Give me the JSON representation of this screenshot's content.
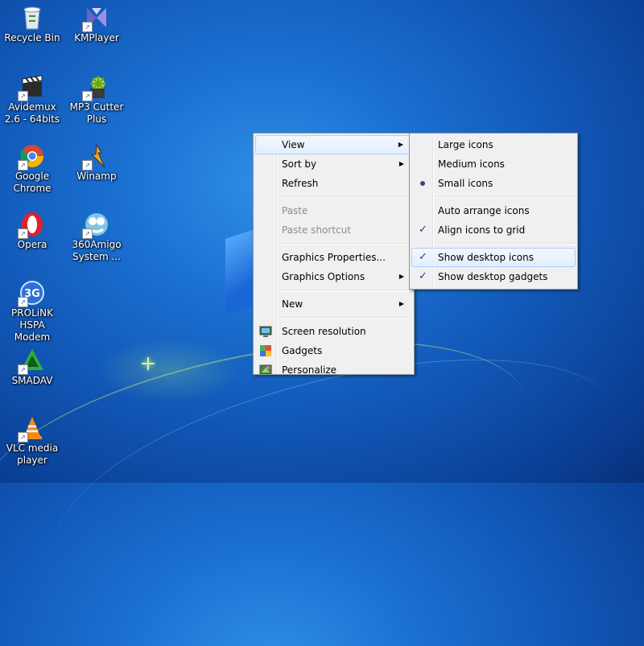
{
  "desktop": {
    "icons": [
      {
        "label": "Recycle Bin",
        "icon": "recycle-bin-icon"
      },
      {
        "label": "KMPlayer",
        "icon": "kmplayer-icon"
      },
      {
        "label": "Avidemux 2.6 - 64bits",
        "icon": "avidemux-icon"
      },
      {
        "label": "MP3 Cutter Plus",
        "icon": "mp3-cutter-icon"
      },
      {
        "label": "Google Chrome",
        "icon": "chrome-icon"
      },
      {
        "label": "Winamp",
        "icon": "winamp-icon"
      },
      {
        "label": "Opera",
        "icon": "opera-icon"
      },
      {
        "label": "360Amigo System ...",
        "icon": "360amigo-icon"
      },
      {
        "label": "PROLiNK HSPA Modem",
        "icon": "prolink-icon"
      },
      {
        "label": "SMADAV",
        "icon": "smadav-icon"
      },
      {
        "label": "VLC media player",
        "icon": "vlc-icon"
      }
    ]
  },
  "context_menu": {
    "items": [
      {
        "label": "View",
        "submenu": true,
        "highlighted": true
      },
      {
        "label": "Sort by",
        "submenu": true
      },
      {
        "label": "Refresh"
      },
      {
        "label": "Paste",
        "disabled": true
      },
      {
        "label": "Paste shortcut",
        "disabled": true
      },
      {
        "label": "Graphics Properties..."
      },
      {
        "label": "Graphics Options",
        "submenu": true
      },
      {
        "label": "New",
        "submenu": true
      },
      {
        "label": "Screen resolution",
        "icon": "screen-resolution-icon"
      },
      {
        "label": "Gadgets",
        "icon": "gadgets-icon"
      },
      {
        "label": "Personalize",
        "icon": "personalize-icon"
      }
    ]
  },
  "view_submenu": {
    "items": [
      {
        "label": "Large icons"
      },
      {
        "label": "Medium icons"
      },
      {
        "label": "Small icons",
        "selected": true
      },
      {
        "label": "Auto arrange icons"
      },
      {
        "label": "Align icons to grid",
        "checked": true
      },
      {
        "label": "Show desktop icons",
        "checked": true,
        "highlighted": true
      },
      {
        "label": "Show desktop gadgets",
        "checked": true
      }
    ]
  },
  "glyphs": {
    "arrow": "▶",
    "check": "✓"
  }
}
